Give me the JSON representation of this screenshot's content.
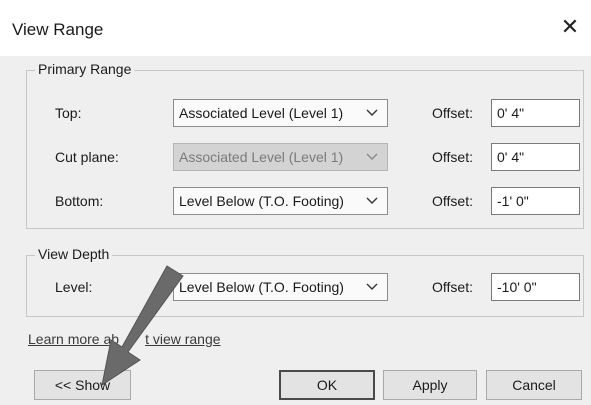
{
  "dialog": {
    "title": "View Range",
    "close_glyph": "✕"
  },
  "primary_range": {
    "label": "Primary Range",
    "rows": [
      {
        "label": "Top:",
        "value": "Associated Level (Level 1)",
        "disabled": false,
        "offset_label": "Offset:",
        "offset": "0'  4\""
      },
      {
        "label": "Cut plane:",
        "value": "Associated Level (Level 1)",
        "disabled": true,
        "offset_label": "Offset:",
        "offset": "0'  4\""
      },
      {
        "label": "Bottom:",
        "value": "Level Below (T.O. Footing)",
        "disabled": false,
        "offset_label": "Offset:",
        "offset": "-1'  0\""
      }
    ]
  },
  "view_depth": {
    "label": "View Depth",
    "row": {
      "label": "Level:",
      "value": "Level Below (T.O. Footing)",
      "offset_label": "Offset:",
      "offset": "-10'  0\""
    }
  },
  "learn_more": {
    "visible_left": "Learn more ab",
    "visible_right": "t view range"
  },
  "buttons": {
    "show": "<< Show",
    "ok": "OK",
    "apply": "Apply",
    "cancel": "Cancel"
  },
  "icons": {
    "close": "close-icon",
    "dropdown": "chevron-down-icon",
    "callout": "arrow-pointer-icon"
  },
  "colors": {
    "dialog_bg": "#efefef",
    "titlebar_bg": "#ffffff",
    "disabled_select_bg": "#d3d3d3",
    "callout_arrow": "#6a6a6a"
  }
}
